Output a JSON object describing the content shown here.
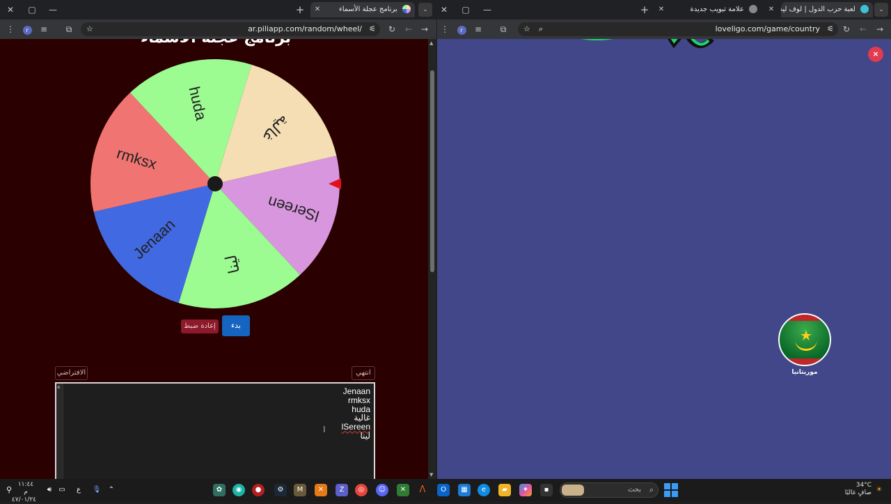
{
  "left_window": {
    "tab_title": "برنامج عجلة الأسماء",
    "url": "ar.piliapp.com/random/wheel/",
    "page_title": "برنامج عجلة الأسماء",
    "start_label": "بدء",
    "reset_label": "إعادة ضبط",
    "default_label": "الافتراضي",
    "done_label": "انتهي",
    "names": [
      "Jenaan",
      "rmksx",
      "huda",
      "غالية",
      "lSereen",
      "لينا"
    ],
    "wheel_segments": [
      {
        "label": "غالية",
        "color": "#f5deb3"
      },
      {
        "label": "lSereen",
        "color": "#d896df"
      },
      {
        "label": "لينا",
        "color": "#9cfc92"
      },
      {
        "label": "Jenaan",
        "color": "#4169e1"
      },
      {
        "label": "rmksx",
        "color": "#f07572"
      },
      {
        "label": "huda",
        "color": "#9cfc92"
      }
    ]
  },
  "right_window": {
    "tab1_title": "لعبة حرب الدول | لوف ليجو لوف",
    "tab2_title": "علامة تبويب جديدة",
    "url": "loveligo.com/game/country",
    "close_label": "×",
    "country_label": "موريتانيا"
  },
  "taskbar": {
    "search_placeholder": "بحث",
    "time": "١١:٤٤ م",
    "date": "٤٧/٠١/٢٤",
    "temperature": "34°C",
    "weather_text": "صافٍ غالبًا",
    "lang": "ع"
  },
  "colors": {
    "left_bg": "#2b0000",
    "right_bg": "#414788",
    "start_btn": "#1565c0",
    "reset_btn": "#8b1a2b",
    "pointer": "#e0101c"
  }
}
